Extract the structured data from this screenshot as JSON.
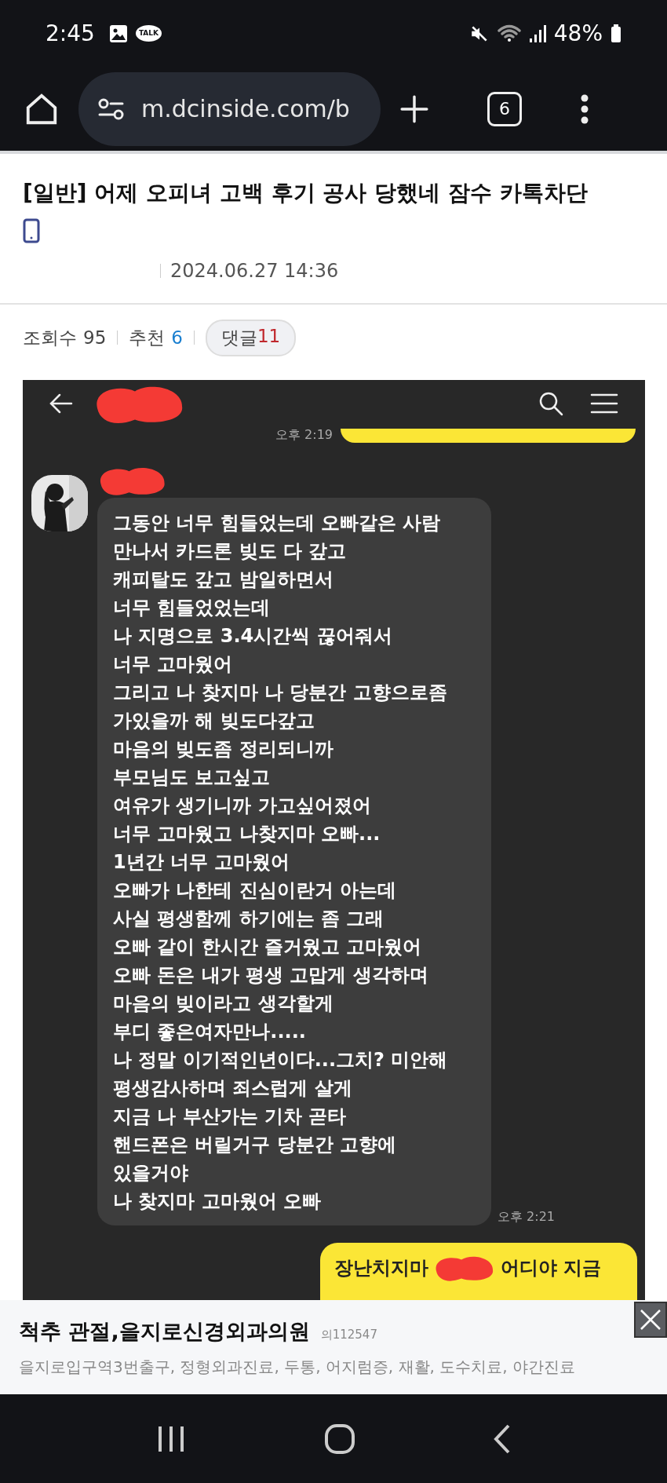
{
  "status_bar": {
    "time": "2:45",
    "talk_badge": "TALK",
    "battery": "48%"
  },
  "browser_bar": {
    "url": "m.dcinside.com/b",
    "tab_count": "6"
  },
  "post": {
    "title": "[일반] 어제 오피녀 고백 후기 공사 당했네 잠수 카톡차단",
    "date": "2024.06.27 14:36",
    "stats": [
      {
        "kind": "plain",
        "label": "조회수",
        "value": "95",
        "color": "#444444"
      },
      {
        "kind": "plain",
        "label": "추천",
        "value": "6",
        "color": "#1a7fd0"
      },
      {
        "kind": "pill",
        "label": "댓글",
        "value": "11",
        "color": "#c0282d"
      }
    ]
  },
  "chat": {
    "first_time": "오후 2:19",
    "message_lines": [
      "그동안 너무 힘들었는데 오빠같은 사람",
      "만나서 카드론 빚도 다 갚고",
      "캐피탈도 갚고 밤일하면서",
      "너무 힘들었었는데",
      "나 지명으로 3.4시간씩 끊어줘서",
      "너무 고마웠어",
      "그리고 나 찾지마 나 당분간 고향으로좀",
      "가있을까 해 빚도다갚고",
      "마음의 빚도좀 정리되니까",
      "부모님도 보고싶고",
      "여유가 생기니까 가고싶어졌어",
      "너무 고마웠고 나찾지마 오빠...",
      "1년간 너무 고마웠어",
      "오빠가 나한테 진심이란거 아는데",
      "사실 평생함께 하기에는 좀 그래",
      "오빠 같이 한시간 즐거웠고 고마웠어",
      "오빠 돈은 내가 평생 고맙게 생각하며",
      "마음의 빚이라고 생각할게",
      "부디 좋은여자만나.....",
      "나 정말 이기적인년이다...그치? 미안해",
      "평생감사하며 죄스럽게 살게",
      "지금 나 부산가는 기차 곧타",
      "핸드폰은 버릴거구 당분간 고향에",
      "있을거야",
      "나 찾지마 고마웠어 오빠"
    ],
    "message_time": "오후 2:21",
    "reply_start": "장난치지마",
    "reply_end": "어디야 지금"
  },
  "ad": {
    "title": "척추 관절,을지로신경외과의원",
    "license": "의112547",
    "description": "을지로입구역3번출구, 정형외과진료, 두통, 어지럼증, 재활, 도수치료, 야간진료"
  }
}
